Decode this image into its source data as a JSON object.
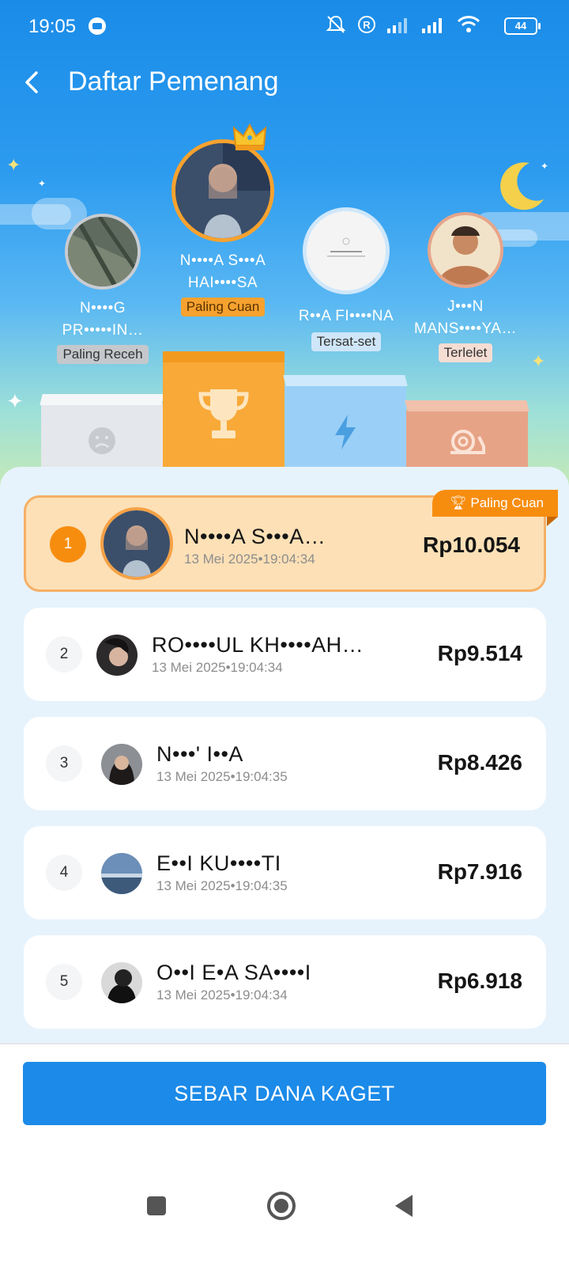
{
  "status_bar": {
    "time": "19:05",
    "battery": "44"
  },
  "header": {
    "title": "Daftar Pemenang"
  },
  "podium": {
    "first": {
      "name_line1": "N••••A S•••A",
      "name_line2": "HAI••••SA",
      "tag": "Paling Cuan"
    },
    "second": {
      "name_line1": "N••••G",
      "name_line2": "PR•••••IN…",
      "tag": "Paling Receh"
    },
    "third": {
      "name_line1": "R••A FI••••NA",
      "name_line2": "",
      "tag": "Tersat-set"
    },
    "fourth": {
      "name_line1": "J•••N",
      "name_line2": "MANS••••YA…",
      "tag": "Terlelet"
    }
  },
  "ribbon_label": "Paling Cuan",
  "winners": [
    {
      "rank": "1",
      "name": "N••••A S•••A…",
      "time": "13 Mei 2025•19:04:34",
      "amount": "Rp10.054"
    },
    {
      "rank": "2",
      "name": "RO••••UL KH••••AH…",
      "time": "13 Mei 2025•19:04:34",
      "amount": "Rp9.514"
    },
    {
      "rank": "3",
      "name": "N•••' I••A",
      "time": "13 Mei 2025•19:04:35",
      "amount": "Rp8.426"
    },
    {
      "rank": "4",
      "name": "E••I KU••••TI",
      "time": "13 Mei 2025•19:04:35",
      "amount": "Rp7.916"
    },
    {
      "rank": "5",
      "name": "O••I E•A SA••••I",
      "time": "13 Mei 2025•19:04:34",
      "amount": "Rp6.918"
    }
  ],
  "cta": {
    "label": "SEBAR DANA KAGET"
  },
  "colors": {
    "primary": "#1b8ae8",
    "gold": "#f78d0f",
    "highlight": "#fde0b6"
  }
}
